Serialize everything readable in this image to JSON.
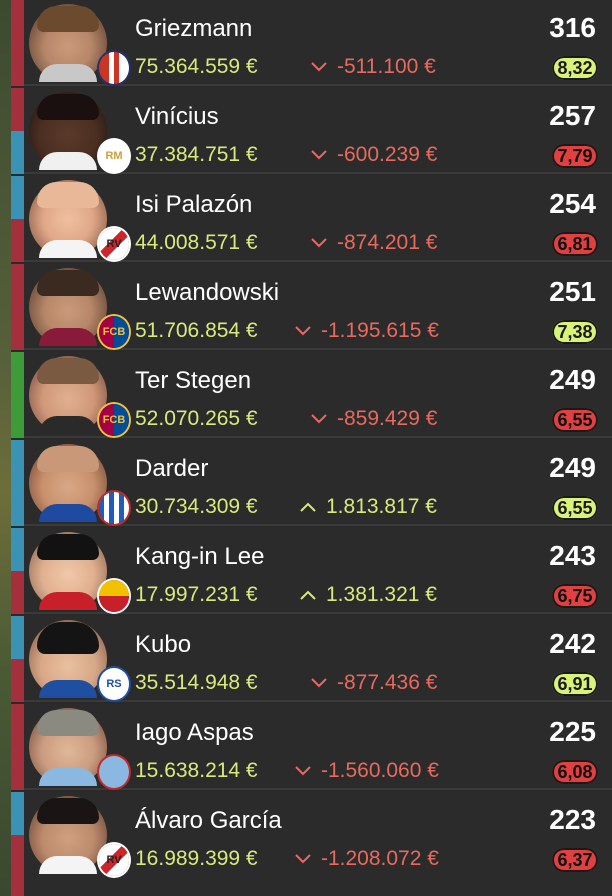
{
  "colors": {
    "position_red": "#a3303c",
    "position_blue": "#3a93b5",
    "position_green": "#3e9b3a",
    "value_green": "#d7ea7c",
    "trend_down": "#e86a5d",
    "avg_good": "#d8f27a",
    "avg_bad": "#e04040"
  },
  "players": [
    {
      "name": "Griezmann",
      "value": "75.364.559 €",
      "trend_dir": "down",
      "trend": "-511.100 €",
      "points": "316",
      "avg": "8,32",
      "avg_tone": "good",
      "club": "atletico-crest-icon"
    },
    {
      "name": "Vinícius",
      "value": "37.384.751 €",
      "trend_dir": "down",
      "trend": "-600.239 €",
      "points": "257",
      "avg": "7,79",
      "avg_tone": "bad",
      "club": "real-madrid-crest-icon"
    },
    {
      "name": "Isi Palazón",
      "value": "44.008.571 €",
      "trend_dir": "down",
      "trend": "-874.201 €",
      "points": "254",
      "avg": "6,81",
      "avg_tone": "bad",
      "club": "rayo-vallecano-crest-icon"
    },
    {
      "name": "Lewandowski",
      "value": "51.706.854 €",
      "trend_dir": "down",
      "trend": "-1.195.615 €",
      "points": "251",
      "avg": "7,38",
      "avg_tone": "good",
      "club": "barcelona-crest-icon"
    },
    {
      "name": "Ter Stegen",
      "value": "52.070.265 €",
      "trend_dir": "down",
      "trend": "-859.429 €",
      "points": "249",
      "avg": "6,55",
      "avg_tone": "bad",
      "club": "barcelona-crest-icon"
    },
    {
      "name": "Darder",
      "value": "30.734.309 €",
      "trend_dir": "up",
      "trend": "1.813.817 €",
      "points": "249",
      "avg": "6,55",
      "avg_tone": "good",
      "club": "espanyol-crest-icon"
    },
    {
      "name": "Kang-in Lee",
      "value": "17.997.231 €",
      "trend_dir": "up",
      "trend": "1.381.321 €",
      "points": "243",
      "avg": "6,75",
      "avg_tone": "bad",
      "club": "mallorca-crest-icon"
    },
    {
      "name": "Kubo",
      "value": "35.514.948 €",
      "trend_dir": "down",
      "trend": "-877.436 €",
      "points": "242",
      "avg": "6,91",
      "avg_tone": "good",
      "club": "real-sociedad-crest-icon"
    },
    {
      "name": "Iago Aspas",
      "value": "15.638.214 €",
      "trend_dir": "down",
      "trend": "-1.560.060 €",
      "points": "225",
      "avg": "6,08",
      "avg_tone": "bad",
      "club": "celta-crest-icon"
    },
    {
      "name": "Álvaro García",
      "value": "16.989.399 €",
      "trend_dir": "down",
      "trend": "-1.208.072 €",
      "points": "223",
      "avg": "6,37",
      "avg_tone": "bad",
      "club": "rayo-vallecano-crest-icon"
    }
  ]
}
